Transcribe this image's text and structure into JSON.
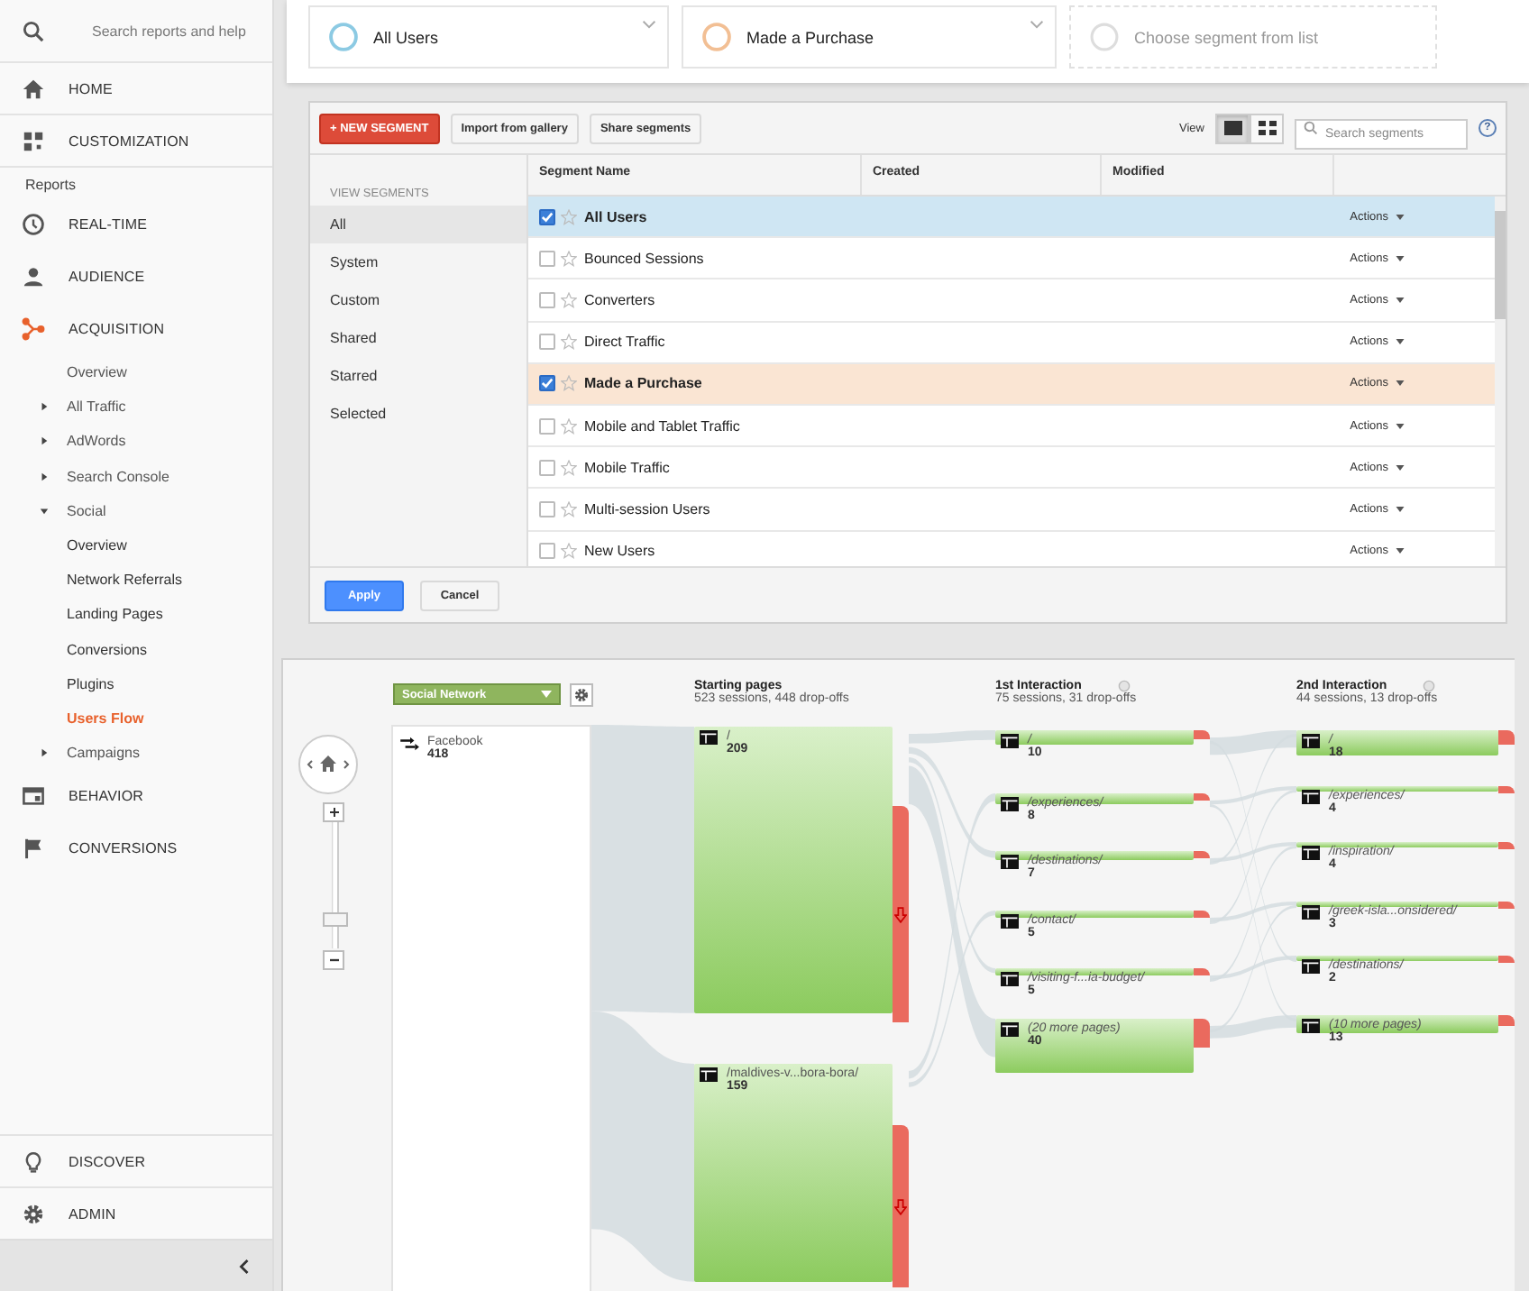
{
  "sidebar": {
    "search": {
      "placeholder": "Search reports and help"
    },
    "top_items": [
      {
        "label": "HOME",
        "selected": false
      },
      {
        "label": "CUSTOMIZATION",
        "selected": false
      }
    ],
    "reports_heading": "Reports",
    "report_items": [
      {
        "label": "REAL-TIME",
        "selected": false
      },
      {
        "label": "AUDIENCE",
        "selected": false
      },
      {
        "label": "ACQUISITION",
        "selected": false,
        "expanded": true,
        "children": [
          {
            "label": "Overview",
            "selected": false
          },
          {
            "label": "All Traffic",
            "selected": false,
            "expanded": false
          },
          {
            "label": "AdWords",
            "selected": false,
            "expanded": false
          },
          {
            "label": "Search Console",
            "selected": false,
            "expanded": false
          },
          {
            "label": "Social",
            "selected": false,
            "expanded": true,
            "children": [
              {
                "label": "Overview",
                "selected": false
              },
              {
                "label": "Network Referrals",
                "selected": false
              },
              {
                "label": "Landing Pages",
                "selected": false
              },
              {
                "label": "Conversions",
                "selected": false
              },
              {
                "label": "Plugins",
                "selected": false
              },
              {
                "label": "Users Flow",
                "selected": true
              }
            ]
          },
          {
            "label": "Campaigns",
            "selected": false,
            "expanded": false
          }
        ]
      },
      {
        "label": "BEHAVIOR",
        "selected": false
      },
      {
        "label": "CONVERSIONS",
        "selected": false
      }
    ],
    "bottom_items": [
      {
        "label": "DISCOVER",
        "selected": false
      },
      {
        "label": "ADMIN",
        "selected": false
      }
    ]
  },
  "segments_bar": [
    {
      "kind": "segment",
      "label": "All Users",
      "color": "#8ccae3"
    },
    {
      "kind": "segment",
      "label": "Made a Purchase",
      "color": "#f2bf94"
    },
    {
      "kind": "empty",
      "label": "Choose segment from list"
    }
  ],
  "segment_panel": {
    "new_button": "+ NEW SEGMENT",
    "buttons": [
      "Import from gallery",
      "Share segments"
    ],
    "view_label": "View",
    "view_options": [
      {
        "selected": true
      },
      {
        "selected": false
      }
    ],
    "search": {
      "placeholder": "Search segments"
    },
    "help": "?",
    "filter_heading": "VIEW SEGMENTS",
    "filters": [
      {
        "label": "All",
        "selected": true
      },
      {
        "label": "System",
        "selected": false
      },
      {
        "label": "Custom",
        "selected": false
      },
      {
        "label": "Shared",
        "selected": false
      },
      {
        "label": "Starred",
        "selected": false
      },
      {
        "label": "Selected",
        "selected": false
      }
    ],
    "columns": [
      "Segment Name",
      "Created",
      "Modified"
    ],
    "rows": [
      {
        "name": "All Users",
        "checked": true,
        "color": "#cfe6f3",
        "action": "Actions"
      },
      {
        "name": "Bounced Sessions",
        "checked": false,
        "action": "Actions"
      },
      {
        "name": "Converters",
        "checked": false,
        "action": "Actions"
      },
      {
        "name": "Direct Traffic",
        "checked": false,
        "action": "Actions"
      },
      {
        "name": "Made a Purchase",
        "checked": true,
        "color": "#fae5d3",
        "action": "Actions"
      },
      {
        "name": "Mobile and Tablet Traffic",
        "checked": false,
        "action": "Actions"
      },
      {
        "name": "Mobile Traffic",
        "checked": false,
        "action": "Actions"
      },
      {
        "name": "Multi-session Users",
        "checked": false,
        "action": "Actions"
      },
      {
        "name": "New Users",
        "checked": false,
        "action": "Actions"
      }
    ],
    "apply_button": "Apply",
    "cancel_button": "Cancel"
  },
  "flow": {
    "dimension": "Social Network",
    "zoom": {
      "level": 0.2
    },
    "source": {
      "label": "Facebook",
      "count": "418"
    },
    "columns": [
      {
        "kind": "start",
        "title": "Starting pages",
        "subtitle": "523 sessions, 448 drop-offs",
        "nodes": [
          {
            "page": "/",
            "count": "209"
          },
          {
            "page": "/maldives-v...bora-bora/",
            "count": "159"
          }
        ]
      },
      {
        "kind": "interaction",
        "title": "1st Interaction",
        "subtitle": "75 sessions, 31 drop-offs",
        "nodes": [
          {
            "page": "/",
            "count": "10"
          },
          {
            "page": "/experiences/",
            "count": "8"
          },
          {
            "page": "/destinations/",
            "count": "7"
          },
          {
            "page": "/contact/",
            "count": "5"
          },
          {
            "page": "/visiting-f...ia-budget/",
            "count": "5"
          },
          {
            "page": "(20 more pages)",
            "count": "40"
          }
        ]
      },
      {
        "kind": "interaction",
        "title": "2nd Interaction",
        "subtitle": "44 sessions, 13 drop-offs",
        "nodes": [
          {
            "page": "/",
            "count": "18"
          },
          {
            "page": "/experiences/",
            "count": "4"
          },
          {
            "page": "/inspiration/",
            "count": "4"
          },
          {
            "page": "/greek-isla...onsidered/",
            "count": "3"
          },
          {
            "page": "/destinations/",
            "count": "2"
          },
          {
            "page": "(10 more pages)",
            "count": "13"
          }
        ]
      }
    ]
  }
}
